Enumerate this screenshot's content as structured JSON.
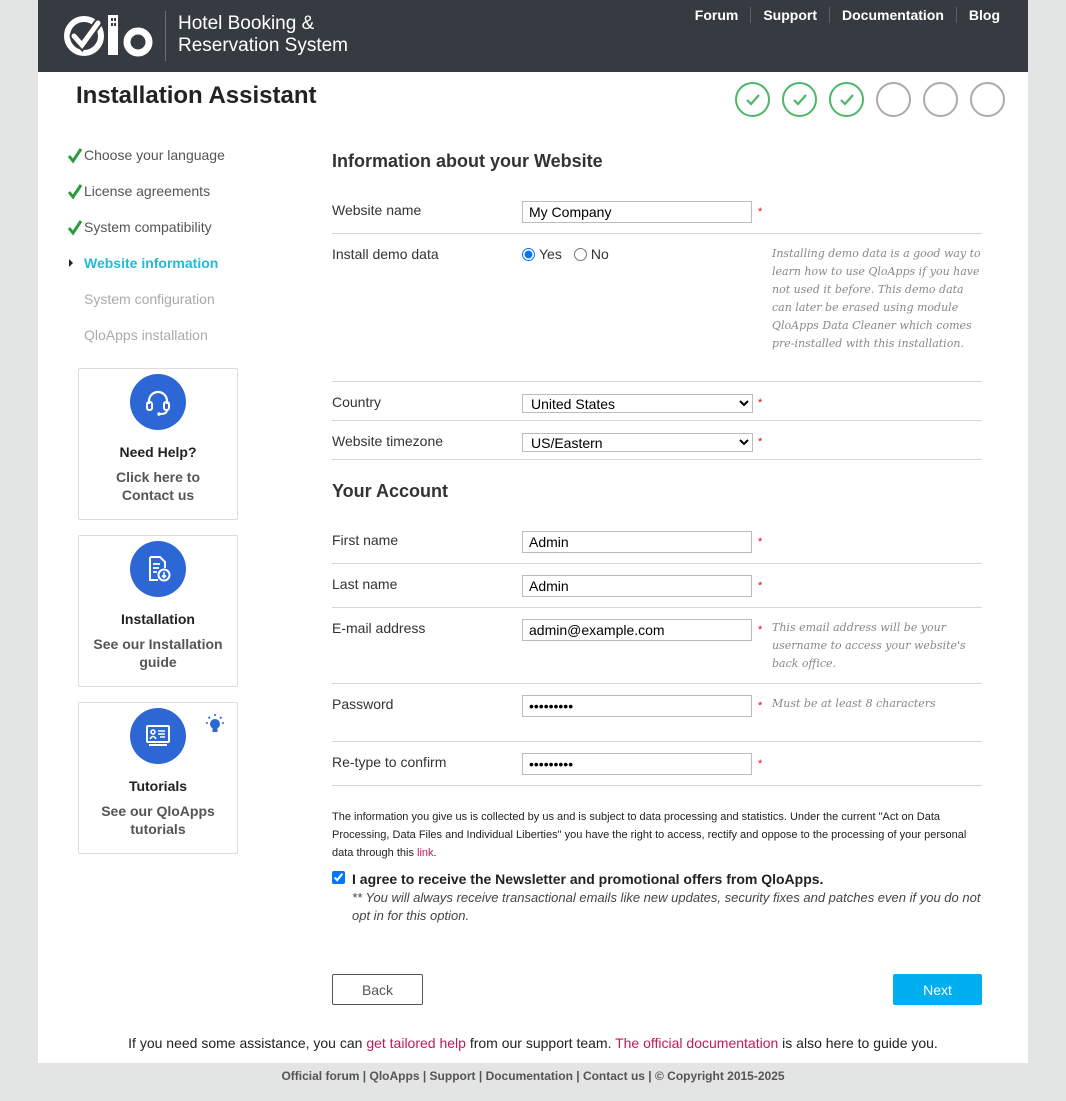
{
  "brand": {
    "line1": "Hotel Booking &",
    "line2": "Reservation System"
  },
  "topnav": [
    "Forum",
    "Support",
    "Documentation",
    "Blog"
  ],
  "title": "Installation Assistant",
  "progress": {
    "completed_steps": 3,
    "total_steps": 6
  },
  "sidenav": [
    {
      "label": "Choose your language",
      "state": "done"
    },
    {
      "label": "License agreements",
      "state": "done"
    },
    {
      "label": "System compatibility",
      "state": "done"
    },
    {
      "label": "Website information",
      "state": "current"
    },
    {
      "label": "System configuration",
      "state": "todo"
    },
    {
      "label": "QloApps installation",
      "state": "todo"
    }
  ],
  "cards": {
    "help": {
      "title": "Need Help?",
      "text": "Click here to Contact us"
    },
    "install": {
      "title": "Installation",
      "text": "See our Installation guide"
    },
    "tutorials": {
      "title": "Tutorials",
      "text": "See our QloApps tutorials"
    }
  },
  "website_section": {
    "heading": "Information about your Website",
    "website_name": {
      "label": "Website name",
      "value": "My Company"
    },
    "demo": {
      "label": "Install demo data",
      "yes": "Yes",
      "no": "No",
      "selected": "Yes",
      "hint": "Installing demo data is a good way to learn how to use QloApps if you have not used it before. This demo data can later be erased using module QloApps Data Cleaner which comes pre-installed with this installation."
    },
    "country": {
      "label": "Country",
      "value": "United States"
    },
    "timezone": {
      "label": "Website timezone",
      "value": "US/Eastern"
    }
  },
  "account_section": {
    "heading": "Your Account",
    "first_name": {
      "label": "First name",
      "value": "Admin"
    },
    "last_name": {
      "label": "Last name",
      "value": "Admin"
    },
    "email": {
      "label": "E-mail address",
      "value": "admin@example.com",
      "hint": "This email address will be your username to access your website's back office."
    },
    "password": {
      "label": "Password",
      "value": "•••••••••",
      "hint": "Must be at least 8 characters"
    },
    "retype": {
      "label": "Re-type to confirm",
      "value": "•••••••••"
    }
  },
  "required_mark": "*",
  "privacy": {
    "text": "The information you give us is collected by us and is subject to data processing and statistics. Under the current \"Act on Data Processing, Data Files and Individual Liberties\" you have the right to access, rectify and oppose to the processing of your personal data through this ",
    "link": "link",
    "end": "."
  },
  "newsletter": {
    "checked": true,
    "label": "I agree to receive the Newsletter and promotional offers from QloApps.",
    "note": "** You will always receive transactional emails like new updates, security fixes and patches even if you do not opt in for this option."
  },
  "buttons": {
    "back": "Back",
    "next": "Next"
  },
  "assist": {
    "pre": "If you need some assistance, you can ",
    "link1": "get tailored help",
    "mid": " from our support team. ",
    "link2": "The official documentation",
    "post": " is also here to guide you."
  },
  "footer": {
    "items": [
      "Official forum",
      "QloApps",
      "Support",
      "Documentation",
      "Contact us"
    ],
    "copyright": "© Copyright 2015-2025"
  },
  "colors": {
    "header": "#363a41",
    "accent": "#25b9d7",
    "primary_button": "#00aff0",
    "done_step": "#4cb766",
    "link": "#c2185b"
  }
}
